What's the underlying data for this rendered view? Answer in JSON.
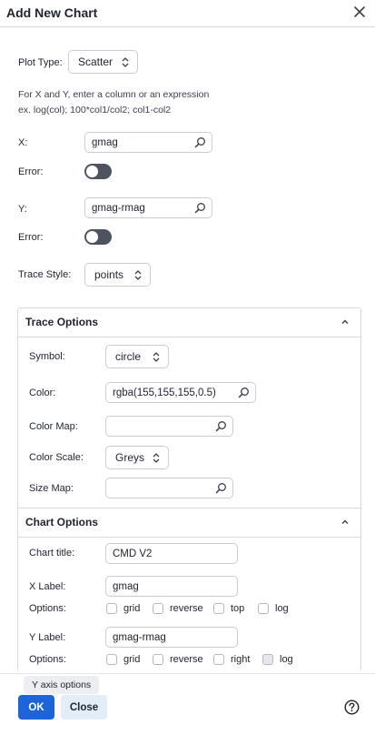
{
  "dialog": {
    "title": "Add New Chart"
  },
  "form": {
    "plot_type_label": "Plot Type:",
    "plot_type_value": "Scatter",
    "instructions_line1": "For X and Y, enter a column or an expression",
    "instructions_line2": "ex. log(col); 100*col1/col2; col1-col2",
    "x_label": "X:",
    "x_value": "gmag",
    "x_error_label": "Error:",
    "x_error_on": false,
    "y_label": "Y:",
    "y_value": "gmag-rmag",
    "y_error_label": "Error:",
    "y_error_on": false,
    "trace_style_label": "Trace Style:",
    "trace_style_value": "points"
  },
  "trace_options": {
    "header": "Trace Options",
    "symbol_label": "Symbol:",
    "symbol_value": "circle",
    "color_label": "Color:",
    "color_value": "rgba(155,155,155,0.5)",
    "color_map_label": "Color Map:",
    "color_map_value": "",
    "color_scale_label": "Color Scale:",
    "color_scale_value": "Greys",
    "size_map_label": "Size Map:",
    "size_map_value": ""
  },
  "chart_options": {
    "header": "Chart Options",
    "chart_title_label": "Chart title:",
    "chart_title_value": "CMD V2",
    "x_label_label": "X Label:",
    "x_label_value": "gmag",
    "x_options_label": "Options:",
    "x_options": [
      {
        "label": "grid",
        "checked": false
      },
      {
        "label": "reverse",
        "checked": false
      },
      {
        "label": "top",
        "checked": false
      },
      {
        "label": "log",
        "checked": false
      }
    ],
    "y_label_label": "Y Label:",
    "y_label_value": "gmag-rmag",
    "y_options_label": "Options:",
    "y_options": [
      {
        "label": "grid",
        "checked": false
      },
      {
        "label": "reverse",
        "checked": false
      },
      {
        "label": "right",
        "checked": false
      },
      {
        "label": "log",
        "checked": false,
        "disabled": true
      }
    ]
  },
  "footer": {
    "tooltip": "Y axis options",
    "ok_label": "OK",
    "close_label": "Close"
  },
  "icons": {
    "close": "close-icon",
    "search": "search-icon",
    "chevron_updown": "chevron-updown-icon",
    "caret_up": "chevron-up-icon",
    "help": "help-icon"
  },
  "colors": {
    "primary": "#1d64d8",
    "toggle_off": "#4d535f",
    "secondary_button": "#e3edf9"
  }
}
